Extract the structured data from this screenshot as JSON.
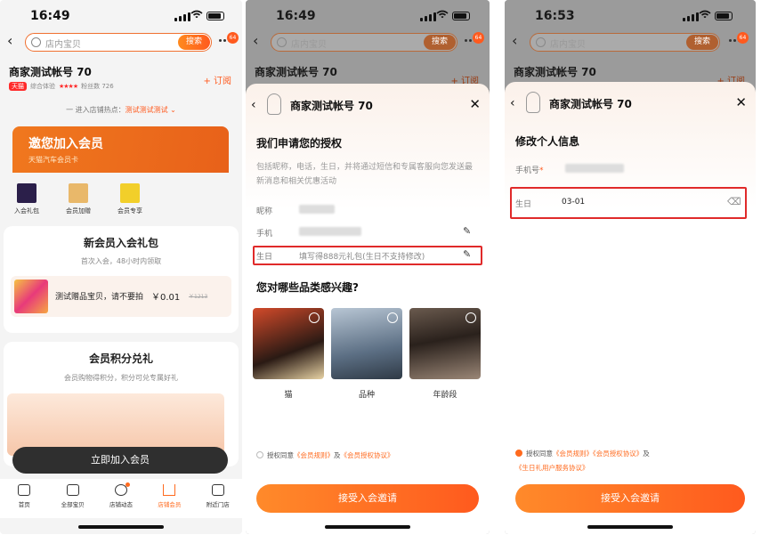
{
  "panel1": {
    "status": {
      "time": "16:49"
    },
    "search": {
      "placeholder": "店内宝贝",
      "button": "搜索",
      "badge": "64"
    },
    "shop": {
      "name": "商家测试帐号 70",
      "tmall_tag": "天猫",
      "rating_label": "综合体验",
      "stars": "★★★★",
      "fans": "粉丝数 726",
      "follow": "+ 订阅"
    },
    "hotline": {
      "prefix": "一 进入店铺热点：",
      "highlight": "测试测试测试 ⌄",
      "suffix": "一"
    },
    "member_card": {
      "title": "邀您加入会员",
      "subtitle": "天猫汽车会员卡"
    },
    "perks": [
      {
        "label": "入会礼包",
        "color": "#2b1f4a"
      },
      {
        "label": "会员加赠",
        "color": "#e9b86a"
      },
      {
        "label": "会员专享",
        "color": "#f2cf2a"
      }
    ],
    "gift": {
      "title": "新会员入会礼包",
      "subtitle": "首次入会，48小时内领取",
      "item_name": "测试赠品宝贝，请不要拍",
      "price": "￥0.01",
      "old_price": "￥1213"
    },
    "points": {
      "title": "会员积分兑礼",
      "subtitle": "会员购物得积分，积分可兑专属好礼"
    },
    "join_button": "立即加入会员",
    "tabs": [
      {
        "label": "首页",
        "icon": "home-icon"
      },
      {
        "label": "全部宝贝",
        "icon": "bag-icon"
      },
      {
        "label": "店铺动态",
        "icon": "broadcast-icon"
      },
      {
        "label": "店铺会员",
        "icon": "crown-icon"
      },
      {
        "label": "附近门店",
        "icon": "store-icon"
      }
    ]
  },
  "panel2": {
    "status": {
      "time": "16:49"
    },
    "search": {
      "placeholder": "店内宝贝",
      "button": "搜索",
      "badge": "64"
    },
    "bg_shop": {
      "name": "商家测试帐号 70",
      "follow": "+ 订阅"
    },
    "sheet": {
      "title": "商家测试帐号 70",
      "heading": "我们申请您的授权",
      "description": "包括昵称，电话，生日，并将通过短信和专属客服向您发送最新消息和相关优惠活动",
      "fields": {
        "nickname": "昵称",
        "phone": "手机",
        "birthday": "生日",
        "birthday_hint": "填写得888元礼包(生日不支持修改)"
      },
      "interest_heading": "您对哪些品类感兴趣?",
      "categories": [
        {
          "label": "猫"
        },
        {
          "label": "品种"
        },
        {
          "label": "年龄段"
        }
      ],
      "agree": {
        "prefix": "授权同意",
        "rules": "《会员规则》",
        "and": "及",
        "protocol": "《会员授权协议》"
      },
      "accept": "接受入会邀请"
    }
  },
  "panel3": {
    "status": {
      "time": "16:53"
    },
    "search": {
      "placeholder": "店内宝贝",
      "button": "搜索",
      "badge": "64"
    },
    "bg_shop": {
      "name": "商家测试帐号 70",
      "follow": "+ 订阅"
    },
    "sheet": {
      "title": "商家测试帐号 70",
      "heading": "修改个人信息",
      "phone_label": "手机号",
      "required_mark": "*",
      "birthday_label": "生日",
      "birthday_value": "03-01",
      "agree": {
        "prefix": "授权同意",
        "rules": "《会员规则》",
        "protocol": "《会员授权协议》",
        "and": "及",
        "extra": "《生日礼用户服务协议》"
      },
      "accept": "接受入会邀请"
    }
  }
}
